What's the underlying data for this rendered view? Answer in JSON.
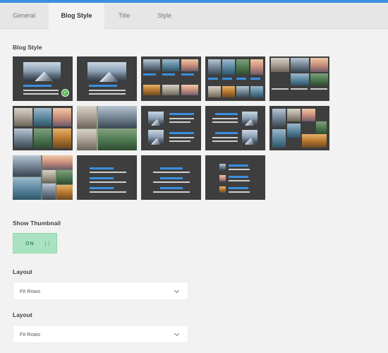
{
  "colors": {
    "accent": "#3a8fe0",
    "toggle_on": "#a9e2c0",
    "thumb_bg": "#3e3e3e",
    "selected_check": "#5cb85c"
  },
  "tabs": [
    {
      "label": "General",
      "active": false
    },
    {
      "label": "Blog Style",
      "active": true
    },
    {
      "label": "Title",
      "active": false
    },
    {
      "label": "Style",
      "active": false
    }
  ],
  "blog_style": {
    "label": "Blog Style",
    "selected_index": 0,
    "thumbnail_count": 13
  },
  "show_thumbnail": {
    "label": "Show Thumbnail",
    "value": "ON"
  },
  "layout_1": {
    "label": "Layout",
    "value": "Fit Rows"
  },
  "layout_2": {
    "label": "Layout",
    "value": "Fit Rows"
  }
}
